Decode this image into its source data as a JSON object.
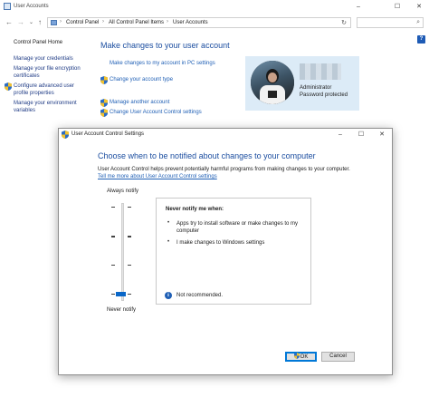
{
  "window": {
    "title": "User Accounts",
    "controls": {
      "minimize": "–",
      "maximize": "☐",
      "close": "✕"
    }
  },
  "address_bar": {
    "back": "←",
    "forward": "→",
    "dropdown": "⌄",
    "up": "↑",
    "crumbs": [
      "Control Panel",
      "All Control Panel Items",
      "User Accounts"
    ],
    "separator": "›",
    "refresh": "↻",
    "search_icon": "search-icon"
  },
  "help_button": "?",
  "left_nav": {
    "items": [
      "Control Panel Home",
      "Manage your credentials",
      "Manage your file encryption",
      "certificates",
      "Configure advanced user",
      "profile properties",
      "Manage your environment",
      "variables"
    ]
  },
  "main": {
    "heading": "Make changes to your user account",
    "links": [
      "Make changes to my account in PC settings",
      "Change your account type",
      "Manage another account",
      "Change User Account Control settings"
    ]
  },
  "user_card": {
    "role": "Administrator",
    "status": "Password protected"
  },
  "dialog": {
    "title": "User Account Control Settings",
    "controls": {
      "minimize": "–",
      "maximize": "☐",
      "close": "✕"
    },
    "heading": "Choose when to be notified about changes to your computer",
    "description": "User Account Control helps prevent potentially harmful programs from making changes to your computer.",
    "learn_more": "Tell me more about User Account Control settings",
    "slider": {
      "top_label": "Always notify",
      "bottom_label": "Never notify",
      "levels": 4,
      "selected_level": 1
    },
    "info": {
      "title": "Never notify me when:",
      "bullets": [
        "Apps try to install software or make changes to my computer",
        "I make changes to Windows settings"
      ],
      "bullet_char": "•",
      "note": "Not recommended.",
      "note_icon": "i"
    },
    "buttons": {
      "ok": "OK",
      "cancel": "Cancel"
    }
  },
  "colors": {
    "link": "#1f5fb5",
    "heading": "#1c4ea0",
    "accent": "#0a67c8",
    "user_card_bg": "#dcebf7"
  }
}
